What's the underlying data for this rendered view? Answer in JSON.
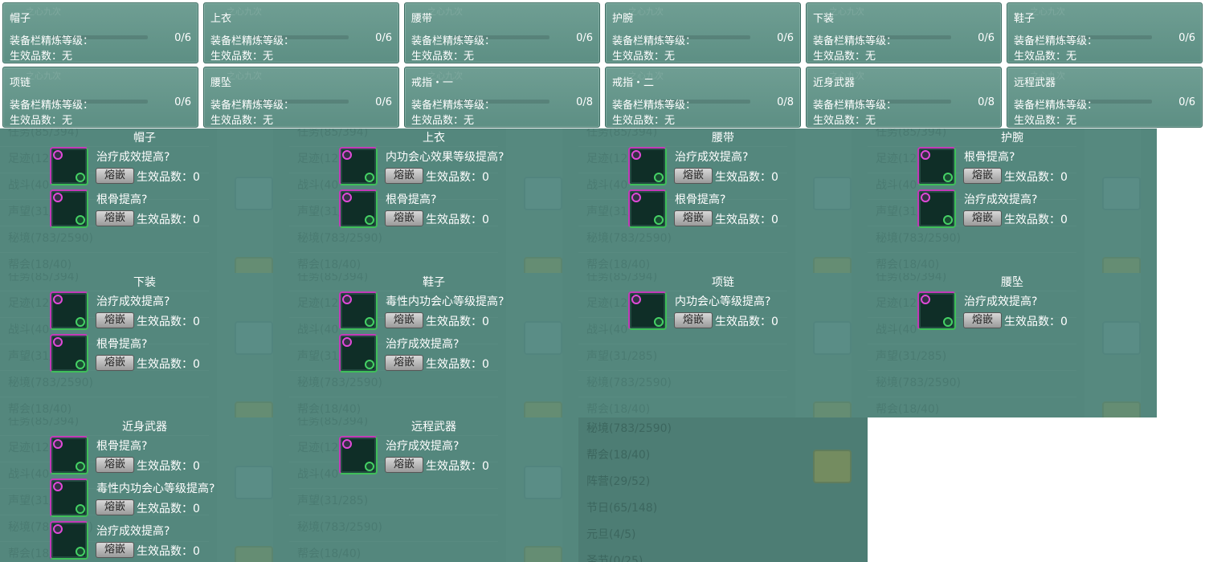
{
  "summary": [
    {
      "name": "帽子",
      "level_label": "装备栏精炼等级：",
      "level_value": "0/6",
      "effect": "生效品数：无"
    },
    {
      "name": "上衣",
      "level_label": "装备栏精炼等级：",
      "level_value": "0/6",
      "effect": "生效品数：无"
    },
    {
      "name": "腰带",
      "level_label": "装备栏精炼等级：",
      "level_value": "0/6",
      "effect": "生效品数：无"
    },
    {
      "name": "护腕",
      "level_label": "装备栏精炼等级：",
      "level_value": "0/6",
      "effect": "生效品数：无"
    },
    {
      "name": "下装",
      "level_label": "装备栏精炼等级：",
      "level_value": "0/6",
      "effect": "生效品数：无"
    },
    {
      "name": "鞋子",
      "level_label": "装备栏精炼等级：",
      "level_value": "0/6",
      "effect": "生效品数：无"
    },
    {
      "name": "项链",
      "level_label": "装备栏精炼等级：",
      "level_value": "0/6",
      "effect": "生效品数：无"
    },
    {
      "name": "腰坠",
      "level_label": "装备栏精炼等级：",
      "level_value": "0/6",
      "effect": "生效品数：无"
    },
    {
      "name": "戒指・一",
      "level_label": "装备栏精炼等级：",
      "level_value": "0/8",
      "effect": "生效品数：无"
    },
    {
      "name": "戒指・二",
      "level_label": "装备栏精炼等级：",
      "level_value": "0/8",
      "effect": "生效品数：无"
    },
    {
      "name": "近身武器",
      "level_label": "装备栏精炼等级：",
      "level_value": "0/8",
      "effect": "生效品数：无"
    },
    {
      "name": "远程武器",
      "level_label": "装备栏精炼等级：",
      "level_value": "0/6",
      "effect": "生效品数：无"
    }
  ],
  "summary_ghost": "之心九次",
  "background_list": [
    "任务(85/394)",
    "足迹(12",
    "战斗(40",
    "声望(31/285)",
    "秘境(783/2590)",
    "帮会(18/40)",
    "阵营(29/52)",
    "节日(65/148)",
    "元旦(4/5)",
    "圣节(0/25)"
  ],
  "slots": [
    {
      "title": "帽子",
      "gems": [
        {
          "attr": "治疗成效提高?",
          "count": "生效品数：0"
        },
        {
          "attr": "根骨提高?",
          "count": "生效品数：0"
        }
      ]
    },
    {
      "title": "上衣",
      "gems": [
        {
          "attr": "内功会心效果等级提高?",
          "count": "生效品数：0"
        },
        {
          "attr": "根骨提高?",
          "count": "生效品数：0"
        }
      ]
    },
    {
      "title": "腰带",
      "gems": [
        {
          "attr": "治疗成效提高?",
          "count": "生效品数：0"
        },
        {
          "attr": "根骨提高?",
          "count": "生效品数：0"
        }
      ]
    },
    {
      "title": "护腕",
      "gems": [
        {
          "attr": "根骨提高?",
          "count": "生效品数：0"
        },
        {
          "attr": "治疗成效提高?",
          "count": "生效品数：0"
        }
      ]
    },
    {
      "title": "下装",
      "gems": [
        {
          "attr": "治疗成效提高?",
          "count": "生效品数：0"
        },
        {
          "attr": "根骨提高?",
          "count": "生效品数：0"
        }
      ]
    },
    {
      "title": "鞋子",
      "gems": [
        {
          "attr": "毒性内功会心等级提高?",
          "count": "生效品数：0"
        },
        {
          "attr": "治疗成效提高?",
          "count": "生效品数：0"
        }
      ]
    },
    {
      "title": "项链",
      "gems": [
        {
          "attr": "内功会心等级提高?",
          "count": "生效品数：0"
        }
      ]
    },
    {
      "title": "腰坠",
      "gems": [
        {
          "attr": "治疗成效提高?",
          "count": "生效品数：0"
        }
      ]
    },
    {
      "title": "近身武器",
      "gems": [
        {
          "attr": "根骨提高?",
          "count": "生效品数：0"
        },
        {
          "attr": "毒性内功会心等级提高?",
          "count": "生效品数：0"
        },
        {
          "attr": "治疗成效提高?",
          "count": "生效品数：0"
        }
      ]
    },
    {
      "title": "远程武器",
      "gems": [
        {
          "attr": "治疗成效提高?",
          "count": "生效品数：0"
        }
      ]
    }
  ],
  "embed_label": "熔嵌"
}
